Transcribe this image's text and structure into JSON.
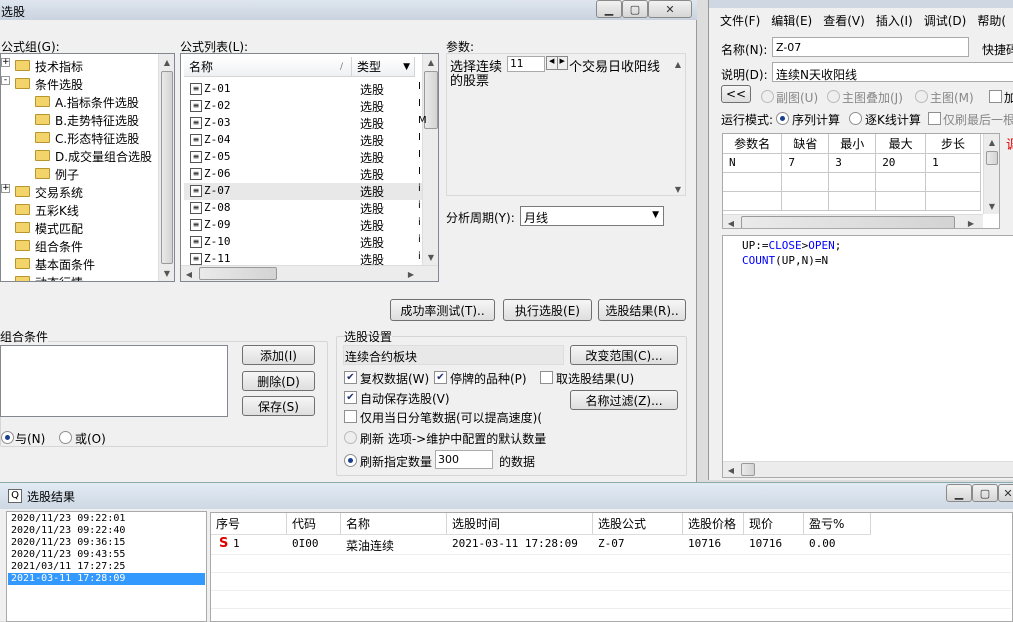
{
  "main": {
    "title": "选股",
    "formula_group_label": "公式组(G):",
    "tree": [
      {
        "label": "技术指标",
        "level": 0,
        "expander": "+"
      },
      {
        "label": "条件选股",
        "level": 0,
        "expander": "-"
      },
      {
        "label": "A.指标条件选股",
        "level": 1
      },
      {
        "label": "B.走势特征选股",
        "level": 1
      },
      {
        "label": "C.形态特征选股",
        "level": 1
      },
      {
        "label": "D.成交量组合选股",
        "level": 1
      },
      {
        "label": "例子",
        "level": 1
      },
      {
        "label": "交易系统",
        "level": 0,
        "expander": "+"
      },
      {
        "label": "五彩K线",
        "level": 0
      },
      {
        "label": "模式匹配",
        "level": 0
      },
      {
        "label": "组合条件",
        "level": 0
      },
      {
        "label": "基本面条件",
        "level": 0
      },
      {
        "label": "动态行情",
        "level": 0
      }
    ],
    "formula_list_label": "公式列表(L):",
    "formula_columns": [
      "名称",
      "类型"
    ],
    "formulas": [
      {
        "name": "Z-01",
        "type": "选股",
        "c": "I"
      },
      {
        "name": "Z-02",
        "type": "选股",
        "c": "I"
      },
      {
        "name": "Z-03",
        "type": "选股",
        "c": "M"
      },
      {
        "name": "Z-04",
        "type": "选股",
        "c": "I"
      },
      {
        "name": "Z-05",
        "type": "选股",
        "c": "I"
      },
      {
        "name": "Z-06",
        "type": "选股",
        "c": "I"
      },
      {
        "name": "Z-07",
        "type": "选股",
        "c": "i"
      },
      {
        "name": "Z-08",
        "type": "选股",
        "c": "i"
      },
      {
        "name": "Z-09",
        "type": "选股",
        "c": "i"
      },
      {
        "name": "Z-10",
        "type": "选股",
        "c": "i"
      },
      {
        "name": "Z-11",
        "type": "选股",
        "c": "i"
      }
    ],
    "params_label": "参数:",
    "param_text_before": "选择连续",
    "param_value": "11",
    "param_text_after": "个交易日收阳线",
    "param_text_line2": "的股票",
    "period_label": "分析周期(Y):",
    "period_value": "月线",
    "btn_test": "成功率测试(T)..",
    "btn_exec": "执行选股(E)",
    "btn_result": "选股结果(R)..",
    "combo_label": "组合条件",
    "btn_add": "添加(I)",
    "btn_delete": "删除(D)",
    "btn_save": "保存(S)",
    "and_label": "与(N)",
    "or_label": "或(O)",
    "settings_label": "选股设置",
    "scope_text": "连续合约板块",
    "btn_change_scope": "改变范围(C)...",
    "btn_name_filter": "名称过滤(Z)...",
    "cb_restore": "复权数据(W)",
    "cb_suspended": "停牌的品种(P)",
    "cb_take_result": "取选股结果(U)",
    "cb_autosave": "自动保存选股(V)",
    "cb_minute": "仅用当日分笔数据(可以提高速度)(",
    "refresh_label": "刷新 选项->维护中配置的默认数量",
    "refresh_count_label": "刷新指定数量",
    "refresh_count": "300",
    "refresh_count_unit": "的数据"
  },
  "editor": {
    "menu": [
      "文件(F)",
      "编辑(E)",
      "查看(V)",
      "插入(I)",
      "调试(D)",
      "帮助("
    ],
    "name_label": "名称(N):",
    "name_value": "Z-07",
    "shortcut_label": "快捷码",
    "desc_label": "说明(D):",
    "desc_value": "连续N天收阳线",
    "back_btn": "<<",
    "radio_sub": "副图(U)",
    "radio_overlay": "主图叠加(J)",
    "radio_main": "主图(M)",
    "cb_add": "加",
    "run_mode_label": "运行模式:",
    "run_seq": "序列计算",
    "run_k": "逐K线计算",
    "run_last": "仅刷最后一根",
    "red_mark": "调",
    "param_columns": [
      "参数名",
      "缺省",
      "最小",
      "最大",
      "步长"
    ],
    "param_rows": [
      [
        "N",
        "7",
        "3",
        "20",
        "1"
      ]
    ],
    "code_line1_a": "UP:=",
    "code_line1_kw1": "CLOSE",
    "code_line1_op": ">",
    "code_line1_kw2": "OPEN",
    "code_line1_end": ";",
    "code_line2_a": "COUNT",
    "code_line2_b": "(UP,N)=N"
  },
  "results": {
    "title": "选股结果",
    "history": [
      "2020/11/23 09:22:01",
      "2020/11/23 09:22:40",
      "2020/11/23 09:36:15",
      "2020/11/23 09:43:55",
      "2021/03/11 17:27:25",
      "2021-03-11 17:28:09"
    ],
    "columns": [
      "序号",
      "代码",
      "名称",
      "选股时间",
      "选股公式",
      "选股价格",
      "现价",
      "盈亏%"
    ],
    "rows": [
      {
        "mark": "S",
        "no": "1",
        "code": "0I00",
        "name": "菜油连续",
        "time": "2021-03-11 17:28:09",
        "formula": "Z-07",
        "price": "10716",
        "now": "10716",
        "pnl": "0.00"
      }
    ]
  },
  "colors": {
    "selection": "#3399ff",
    "keyword": "#0000ff",
    "mark": "#e00000"
  }
}
